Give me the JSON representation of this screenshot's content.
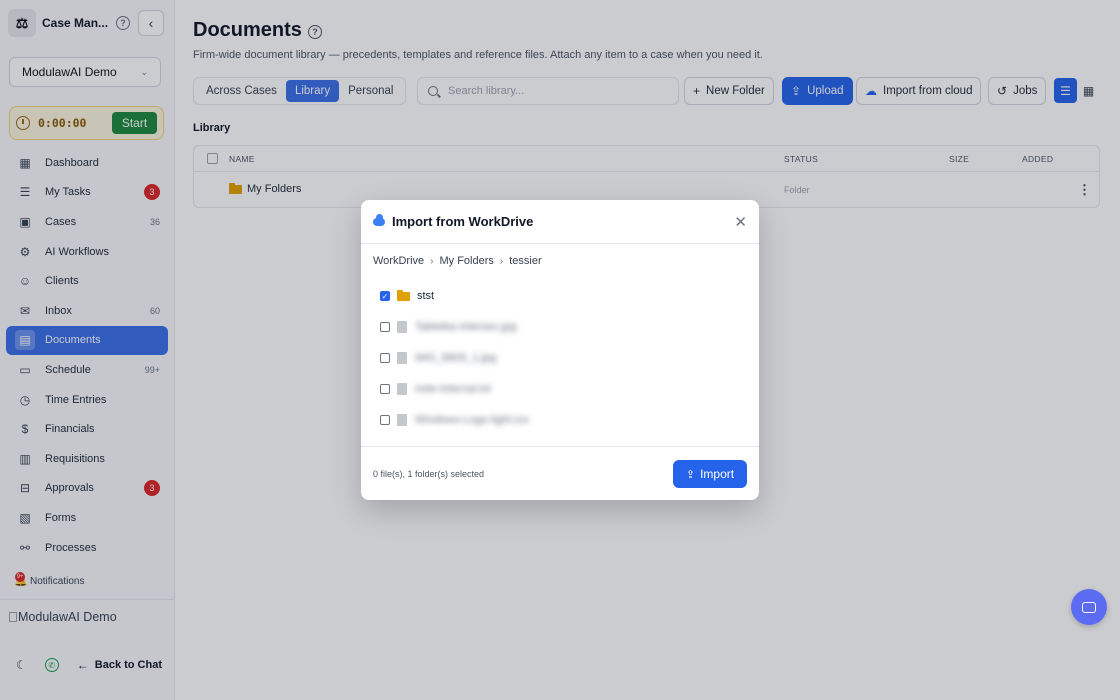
{
  "app": {
    "title": "Case Man...",
    "org": "ModulawAI Demo"
  },
  "timer": {
    "value": "0:00:00",
    "start_label": "Start"
  },
  "sidebar": {
    "items": [
      {
        "label": "Dashboard",
        "icon": "dashboard-icon",
        "badge": "",
        "count": ""
      },
      {
        "label": "My Tasks",
        "icon": "tasks-icon",
        "badge": "3",
        "count": ""
      },
      {
        "label": "Cases",
        "icon": "briefcase-icon",
        "badge": "",
        "count": "36"
      },
      {
        "label": "AI Workflows",
        "icon": "robot-icon",
        "badge": "",
        "count": ""
      },
      {
        "label": "Clients",
        "icon": "users-icon",
        "badge": "",
        "count": ""
      },
      {
        "label": "Inbox",
        "icon": "inbox-icon",
        "badge": "",
        "count": "60"
      },
      {
        "label": "Documents",
        "icon": "document-icon",
        "badge": "",
        "count": ""
      },
      {
        "label": "Schedule",
        "icon": "calendar-icon",
        "badge": "",
        "count": "99+"
      },
      {
        "label": "Time Entries",
        "icon": "clock-icon",
        "badge": "",
        "count": ""
      },
      {
        "label": "Financials",
        "icon": "dollar-icon",
        "badge": "",
        "count": ""
      },
      {
        "label": "Requisitions",
        "icon": "requisition-icon",
        "badge": "",
        "count": ""
      },
      {
        "label": "Approvals",
        "icon": "approval-icon",
        "badge": "3",
        "count": ""
      },
      {
        "label": "Forms",
        "icon": "form-icon",
        "badge": "",
        "count": ""
      },
      {
        "label": "Processes",
        "icon": "process-icon",
        "badge": "",
        "count": ""
      }
    ],
    "notifications_label": "Notifications",
    "notifications_badge": "9+",
    "demo_image_alt": "ModulawAI Demo",
    "back_to_chat": "Back to Chat"
  },
  "page": {
    "title": "Documents",
    "subtitle": "Firm-wide document library — precedents, templates and reference files. Attach any item to a case when you need it.",
    "tabs": [
      "Across Cases",
      "Library",
      "Personal"
    ],
    "active_tab": "Library",
    "search_placeholder": "Search library...",
    "toolbar": {
      "new_folder": "New Folder",
      "upload": "Upload",
      "import_cloud": "Import from cloud",
      "jobs": "Jobs"
    },
    "section_label": "Library",
    "table": {
      "columns": [
        "NAME",
        "STATUS",
        "SIZE",
        "ADDED"
      ],
      "rows": [
        {
          "name": "My Folders",
          "status": "Folder",
          "size": "",
          "added": ""
        }
      ]
    }
  },
  "modal": {
    "title": "Import from WorkDrive",
    "breadcrumb": [
      "WorkDrive",
      "My Folders",
      "tessier"
    ],
    "items": [
      {
        "name": "stst",
        "type": "folder",
        "checked": true
      },
      {
        "name": "Tabletka-Intersex.jpg",
        "type": "file",
        "checked": false
      },
      {
        "name": "IMG_8809_1.jpg",
        "type": "file",
        "checked": false
      },
      {
        "name": "note-internal.txt",
        "type": "file",
        "checked": false
      },
      {
        "name": "Windows-Logo-light.ico",
        "type": "file",
        "checked": false
      }
    ],
    "selection_text": "0 file(s), 1 folder(s) selected",
    "import_label": "Import"
  },
  "colors": {
    "accent": "#2563eb",
    "active_nav": "#3b6fe8",
    "start": "#1e8a3e",
    "badge": "#dc2626",
    "folder": "#e0a100",
    "fab": "#5b6cf2"
  }
}
